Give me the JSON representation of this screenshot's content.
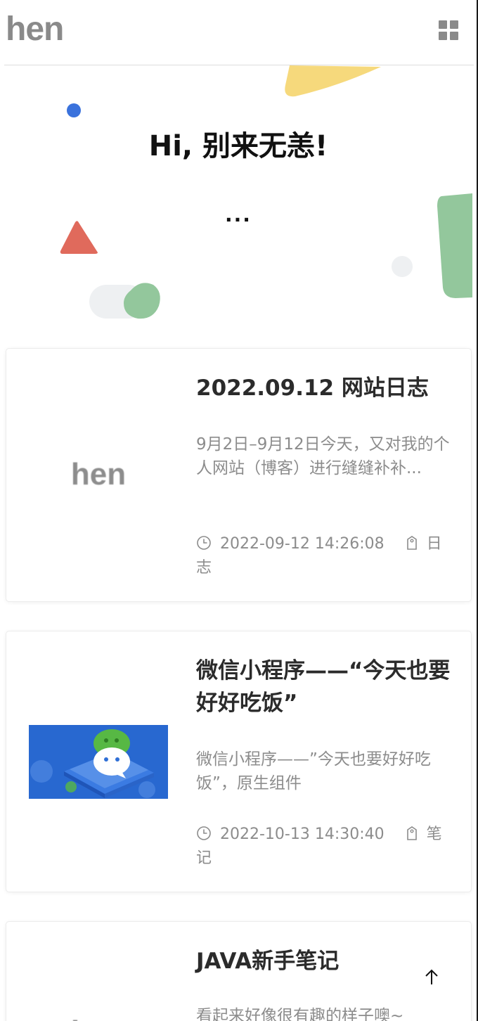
{
  "site": {
    "logo": "hen",
    "menu_icon": "grid-menu-icon"
  },
  "hero": {
    "greeting": "Hi, 别来无恙!",
    "subtitle": "...",
    "decor_colors": {
      "blue": "#3a72dc",
      "yellow": "#f6d97c",
      "red": "#e06a5c",
      "green": "#93c79c",
      "gray": "#eef0f2"
    }
  },
  "posts": [
    {
      "title": "2022.09.12 网站日志",
      "excerpt": "9月2日–9月12日今天，又对我的个人网站（博客）进行缝缝补补...",
      "date": "2022-09-12 14:26:08",
      "category": "日志",
      "thumb_text": "hen"
    },
    {
      "title": "微信小程序——“今天也要好好吃饭”",
      "excerpt": "微信小程序——”今天也要好好吃饭”，原生组件",
      "date": "2022-10-13 14:30:40",
      "category": "笔记",
      "thumb_text": ""
    },
    {
      "title": "JAVA新手笔记",
      "excerpt": "看起来好像很有趣的样子噢~",
      "date": "",
      "category": "",
      "thumb_text": "hen"
    }
  ],
  "back_to_top_icon": "arrow-up-icon"
}
